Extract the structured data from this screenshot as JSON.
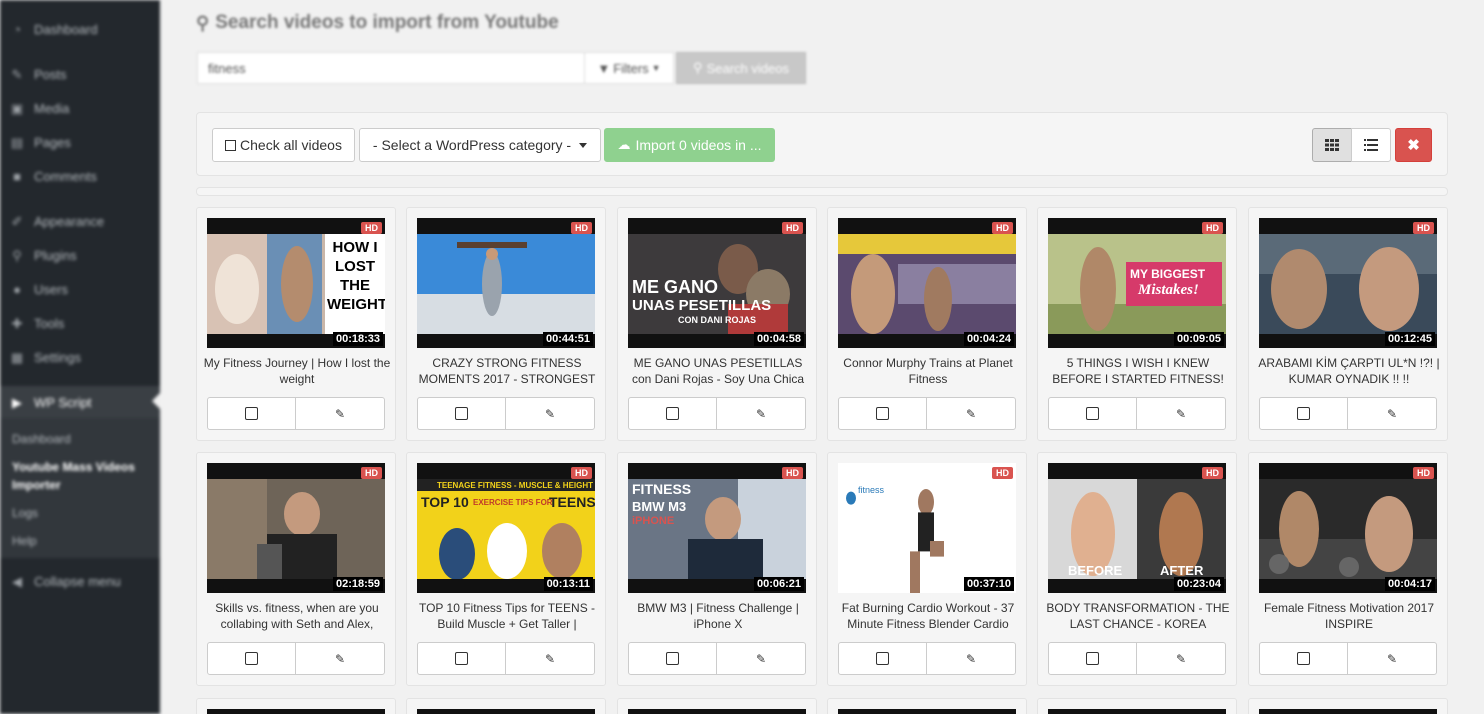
{
  "sidebar": {
    "items": [
      {
        "label": "Dashboard",
        "icon": "dashboard-icon"
      },
      {
        "label": "Posts",
        "icon": "pin-icon"
      },
      {
        "label": "Media",
        "icon": "media-icon"
      },
      {
        "label": "Pages",
        "icon": "page-icon"
      },
      {
        "label": "Comments",
        "icon": "comment-icon"
      },
      {
        "label": "Appearance",
        "icon": "brush-icon"
      },
      {
        "label": "Plugins",
        "icon": "plug-icon"
      },
      {
        "label": "Users",
        "icon": "user-icon"
      },
      {
        "label": "Tools",
        "icon": "wrench-icon"
      },
      {
        "label": "Settings",
        "icon": "settings-icon"
      },
      {
        "label": "WP Script",
        "icon": "play-icon"
      }
    ],
    "submenu": [
      "Dashboard",
      "Youtube Mass Videos Importer",
      "Logs",
      "Help"
    ],
    "collapse": "Collapse menu"
  },
  "search": {
    "title": "Search videos to import from Youtube",
    "keyword": "fitness",
    "filters_label": "Filters",
    "search_label": "Search videos"
  },
  "toolbar": {
    "check_all": "Check all videos",
    "category": "- Select a WordPress category -",
    "import": "Import 0 videos in ...",
    "close": "✖"
  },
  "videos": [
    {
      "title": "My Fitness Journey | How I lost the weight",
      "duration": "00:18:33",
      "hd": "HD"
    },
    {
      "title": "CRAZY STRONG FITNESS MOMENTS 2017 - STRONGEST",
      "duration": "00:44:51",
      "hd": "HD"
    },
    {
      "title": "ME GANO UNAS PESETILLAS con Dani Rojas - Soy Una Chica",
      "duration": "00:04:58",
      "hd": "HD"
    },
    {
      "title": "Connor Murphy Trains at Planet Fitness",
      "duration": "00:04:24",
      "hd": "HD"
    },
    {
      "title": "5 THINGS I WISH I KNEW BEFORE I STARTED FITNESS!",
      "duration": "00:09:05",
      "hd": "HD"
    },
    {
      "title": "ARABAMI KİM ÇARPTI UL*N !?! | KUMAR OYNADIK !! !!",
      "duration": "00:12:45",
      "hd": "HD"
    },
    {
      "title": "Skills vs. fitness, when are you collabing with Seth and Alex,",
      "duration": "02:18:59",
      "hd": "HD"
    },
    {
      "title": "TOP 10 Fitness Tips for TEENS - Build Muscle + Get Taller |",
      "duration": "00:13:11",
      "hd": "HD"
    },
    {
      "title": "BMW M3 | Fitness Challenge | iPhone X",
      "duration": "00:06:21",
      "hd": "HD"
    },
    {
      "title": "Fat Burning Cardio Workout - 37 Minute Fitness Blender Cardio",
      "duration": "00:37:10",
      "hd": "HD"
    },
    {
      "title": "BODY TRANSFORMATION - THE LAST CHANCE - KOREA",
      "duration": "00:23:04",
      "hd": "HD"
    },
    {
      "title": "Female Fitness Motivation 2017 INSPIRE",
      "duration": "00:04:17",
      "hd": "HD"
    }
  ],
  "thumb_text": {
    "t1": "HOW I LOST THE WEIGHT",
    "t3a": "ME GANO",
    "t3b": "UNAS PESETILLAS",
    "t3c": "CON DANI ROJAS",
    "t5a": "MY BIGGEST",
    "t5b": "Mistakes!",
    "t8a": "TEENAGE FITNESS - MUSCLE & HEIGHT",
    "t8b": "TOP 10",
    "t8c": "EXERCISE TIPS FOR",
    "t8d": "TEENS",
    "t9a": "FITNESS",
    "t9b": "BMW M3",
    "t9c": "iPHONE",
    "t10": "fitness",
    "t11a": "BEFORE",
    "t11b": "AFTER"
  }
}
